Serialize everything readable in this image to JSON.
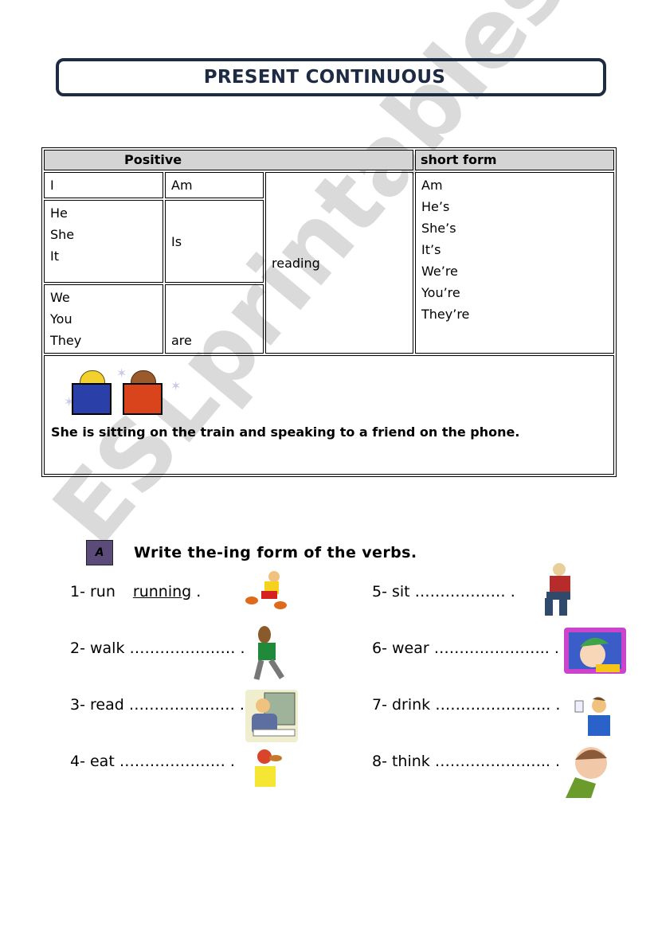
{
  "title": "PRESENT CONTINUOUS",
  "table": {
    "header_positive": "Positive",
    "header_short": "short form",
    "rows": [
      {
        "subjects": [
          "I"
        ],
        "verb": "Am"
      },
      {
        "subjects": [
          "He",
          "She",
          "It"
        ],
        "verb": "Is"
      },
      {
        "subjects": [
          "We",
          "You",
          "They"
        ],
        "verb": "are"
      }
    ],
    "main_verb": "reading",
    "short_forms": [
      "Am",
      "He’s",
      "She’s",
      "It’s",
      "We’re",
      "You’re",
      "They’re"
    ],
    "example_sentence": "She is sitting on the train and speaking to a friend on the phone."
  },
  "exercise": {
    "badge": "A",
    "instruction": "Write the-ing form of the verbs.",
    "items": [
      {
        "label": "1-  run",
        "answer": "running",
        "blank": " ."
      },
      {
        "label": "2- walk",
        "blank": " ………………… ."
      },
      {
        "label": "3- read",
        "blank": " ………………… ."
      },
      {
        "label": "4- eat",
        "blank": " ………………… ."
      },
      {
        "label": "5- sit",
        "blank": " ……………… ."
      },
      {
        "label": "6- wear",
        "blank": " ………………….. ."
      },
      {
        "label": "7- drink",
        "blank": " ………………….. ."
      },
      {
        "label": "8- think",
        "blank": " ………………….. ."
      }
    ]
  },
  "watermark": "ESLprintables.com"
}
